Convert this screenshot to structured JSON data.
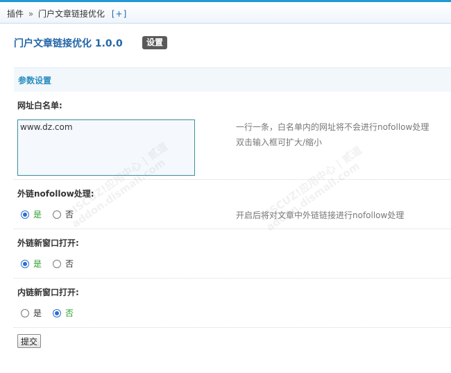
{
  "breadcrumb": {
    "root": "插件",
    "separator": "»",
    "current": "门户文章链接优化",
    "add": "[+]"
  },
  "plugin": {
    "title": "门户文章链接优化 1.0.0",
    "settings_label": "设置"
  },
  "section": {
    "title": "参数设置"
  },
  "whitelist": {
    "label": "网址白名单:",
    "value": "www.dz.com",
    "tip_line1": "一行一条，白名单内的网址将不会进行nofollow处理",
    "tip_line2": "双击输入框可扩大/缩小"
  },
  "external_nofollow": {
    "label": "外链nofollow处理:",
    "yes": "是",
    "no": "否",
    "selected": "yes",
    "tip": "开启后将对文章中外链链接进行nofollow处理"
  },
  "external_newwindow": {
    "label": "外链新窗口打开:",
    "yes": "是",
    "no": "否",
    "selected": "yes"
  },
  "internal_newwindow": {
    "label": "内链新窗口打开:",
    "yes": "是",
    "no": "否",
    "selected": "no"
  },
  "submit_label": "提交",
  "watermark": {
    "line1": "DISCUZ!应用中心 | 贰道",
    "line2": "addon.dismall.com"
  },
  "colors": {
    "accent": "#1f99d6",
    "title": "#2366a8",
    "section": "#2b8fc0",
    "selected_text": "#2a9d2a"
  }
}
